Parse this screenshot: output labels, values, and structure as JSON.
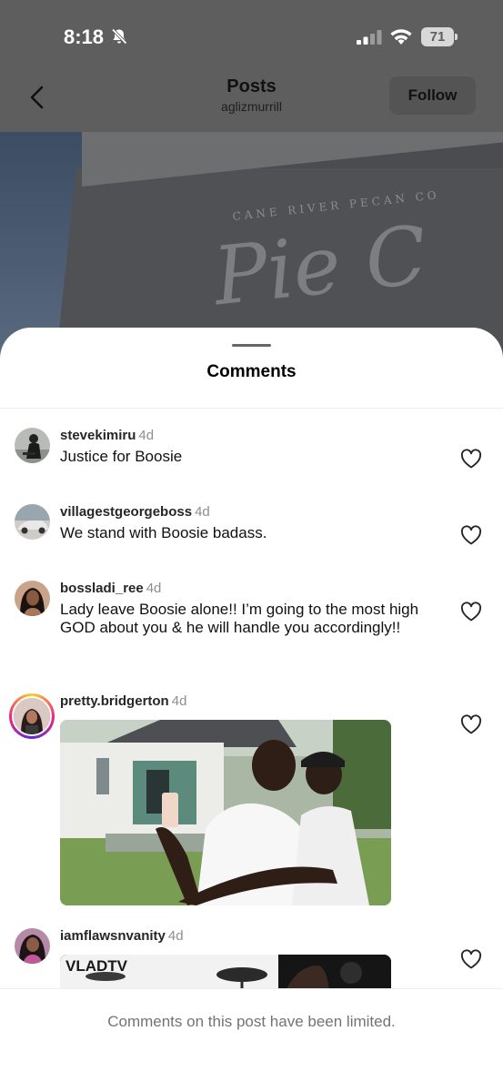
{
  "status_bar": {
    "time": "8:18",
    "battery": "71",
    "icons": [
      "bell-off-icon",
      "signal-icon",
      "wifi-icon",
      "battery-icon"
    ]
  },
  "nav": {
    "title": "Posts",
    "subtitle": "aglizmurrill",
    "follow_label": "Follow",
    "back_icon": "chevron-left-icon"
  },
  "post_image": {
    "sign_small": "CANE RIVER PECAN CO",
    "sign_big": "Pie C"
  },
  "sheet": {
    "title": "Comments"
  },
  "comments": [
    {
      "username": "stevekimiru",
      "time": "4d",
      "text": "Justice for Boosie"
    },
    {
      "username": "villagestgeorgeboss",
      "time": "4d",
      "text": "We stand with Boosie badass."
    },
    {
      "username": "bossladi_ree",
      "time": "4d",
      "text": "Lady leave Boosie alone!! I’m going to the most high GOD about you & he will handle you accordingly!!"
    },
    {
      "username": "pretty.bridgerton",
      "time": "4d",
      "text": ""
    },
    {
      "username": "iamflawsnvanity",
      "time": "4d",
      "text": "",
      "gif_label": "VLADTV"
    }
  ],
  "footer": {
    "text": "Comments on this post have been limited."
  },
  "colors": {
    "dim_overlay": "#5e5e5e",
    "muted_text": "#8e8e8e",
    "footer_text": "#737373",
    "story_ring": [
      "#f9ce34",
      "#ee2a7b",
      "#6228d7"
    ]
  }
}
